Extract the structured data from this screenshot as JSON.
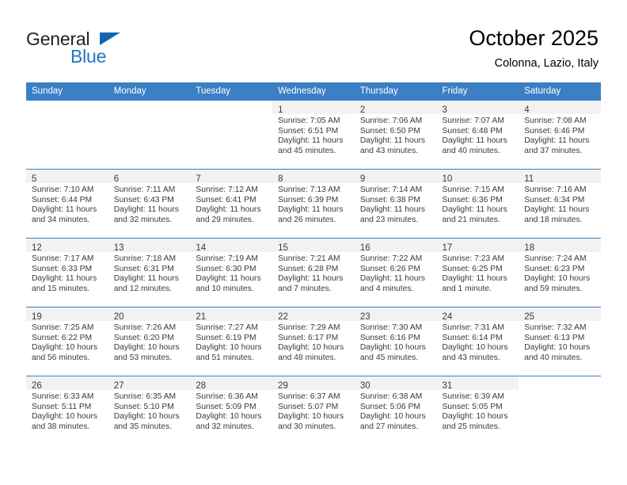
{
  "brand": {
    "name_part1": "General",
    "name_part2": "Blue",
    "accent_color": "#2175c4",
    "triangle_color": "#1565ad",
    "logo_icon": "triangle-icon"
  },
  "header": {
    "title": "October 2025",
    "subtitle": "Colonna, Lazio, Italy"
  },
  "calendar": {
    "header_bg": "#3b7fc4",
    "daynum_bg": "#f2f2f2",
    "weekday_labels": [
      "Sunday",
      "Monday",
      "Tuesday",
      "Wednesday",
      "Thursday",
      "Friday",
      "Saturday"
    ],
    "weeks": [
      [
        {
          "day": "",
          "lines": []
        },
        {
          "day": "",
          "lines": []
        },
        {
          "day": "",
          "lines": []
        },
        {
          "day": "1",
          "lines": [
            "Sunrise: 7:05 AM",
            "Sunset: 6:51 PM",
            "Daylight: 11 hours",
            "and 45 minutes."
          ]
        },
        {
          "day": "2",
          "lines": [
            "Sunrise: 7:06 AM",
            "Sunset: 6:50 PM",
            "Daylight: 11 hours",
            "and 43 minutes."
          ]
        },
        {
          "day": "3",
          "lines": [
            "Sunrise: 7:07 AM",
            "Sunset: 6:48 PM",
            "Daylight: 11 hours",
            "and 40 minutes."
          ]
        },
        {
          "day": "4",
          "lines": [
            "Sunrise: 7:08 AM",
            "Sunset: 6:46 PM",
            "Daylight: 11 hours",
            "and 37 minutes."
          ]
        }
      ],
      [
        {
          "day": "5",
          "lines": [
            "Sunrise: 7:10 AM",
            "Sunset: 6:44 PM",
            "Daylight: 11 hours",
            "and 34 minutes."
          ]
        },
        {
          "day": "6",
          "lines": [
            "Sunrise: 7:11 AM",
            "Sunset: 6:43 PM",
            "Daylight: 11 hours",
            "and 32 minutes."
          ]
        },
        {
          "day": "7",
          "lines": [
            "Sunrise: 7:12 AM",
            "Sunset: 6:41 PM",
            "Daylight: 11 hours",
            "and 29 minutes."
          ]
        },
        {
          "day": "8",
          "lines": [
            "Sunrise: 7:13 AM",
            "Sunset: 6:39 PM",
            "Daylight: 11 hours",
            "and 26 minutes."
          ]
        },
        {
          "day": "9",
          "lines": [
            "Sunrise: 7:14 AM",
            "Sunset: 6:38 PM",
            "Daylight: 11 hours",
            "and 23 minutes."
          ]
        },
        {
          "day": "10",
          "lines": [
            "Sunrise: 7:15 AM",
            "Sunset: 6:36 PM",
            "Daylight: 11 hours",
            "and 21 minutes."
          ]
        },
        {
          "day": "11",
          "lines": [
            "Sunrise: 7:16 AM",
            "Sunset: 6:34 PM",
            "Daylight: 11 hours",
            "and 18 minutes."
          ]
        }
      ],
      [
        {
          "day": "12",
          "lines": [
            "Sunrise: 7:17 AM",
            "Sunset: 6:33 PM",
            "Daylight: 11 hours",
            "and 15 minutes."
          ]
        },
        {
          "day": "13",
          "lines": [
            "Sunrise: 7:18 AM",
            "Sunset: 6:31 PM",
            "Daylight: 11 hours",
            "and 12 minutes."
          ]
        },
        {
          "day": "14",
          "lines": [
            "Sunrise: 7:19 AM",
            "Sunset: 6:30 PM",
            "Daylight: 11 hours",
            "and 10 minutes."
          ]
        },
        {
          "day": "15",
          "lines": [
            "Sunrise: 7:21 AM",
            "Sunset: 6:28 PM",
            "Daylight: 11 hours",
            "and 7 minutes."
          ]
        },
        {
          "day": "16",
          "lines": [
            "Sunrise: 7:22 AM",
            "Sunset: 6:26 PM",
            "Daylight: 11 hours",
            "and 4 minutes."
          ]
        },
        {
          "day": "17",
          "lines": [
            "Sunrise: 7:23 AM",
            "Sunset: 6:25 PM",
            "Daylight: 11 hours",
            "and 1 minute."
          ]
        },
        {
          "day": "18",
          "lines": [
            "Sunrise: 7:24 AM",
            "Sunset: 6:23 PM",
            "Daylight: 10 hours",
            "and 59 minutes."
          ]
        }
      ],
      [
        {
          "day": "19",
          "lines": [
            "Sunrise: 7:25 AM",
            "Sunset: 6:22 PM",
            "Daylight: 10 hours",
            "and 56 minutes."
          ]
        },
        {
          "day": "20",
          "lines": [
            "Sunrise: 7:26 AM",
            "Sunset: 6:20 PM",
            "Daylight: 10 hours",
            "and 53 minutes."
          ]
        },
        {
          "day": "21",
          "lines": [
            "Sunrise: 7:27 AM",
            "Sunset: 6:19 PM",
            "Daylight: 10 hours",
            "and 51 minutes."
          ]
        },
        {
          "day": "22",
          "lines": [
            "Sunrise: 7:29 AM",
            "Sunset: 6:17 PM",
            "Daylight: 10 hours",
            "and 48 minutes."
          ]
        },
        {
          "day": "23",
          "lines": [
            "Sunrise: 7:30 AM",
            "Sunset: 6:16 PM",
            "Daylight: 10 hours",
            "and 45 minutes."
          ]
        },
        {
          "day": "24",
          "lines": [
            "Sunrise: 7:31 AM",
            "Sunset: 6:14 PM",
            "Daylight: 10 hours",
            "and 43 minutes."
          ]
        },
        {
          "day": "25",
          "lines": [
            "Sunrise: 7:32 AM",
            "Sunset: 6:13 PM",
            "Daylight: 10 hours",
            "and 40 minutes."
          ]
        }
      ],
      [
        {
          "day": "26",
          "lines": [
            "Sunrise: 6:33 AM",
            "Sunset: 5:11 PM",
            "Daylight: 10 hours",
            "and 38 minutes."
          ]
        },
        {
          "day": "27",
          "lines": [
            "Sunrise: 6:35 AM",
            "Sunset: 5:10 PM",
            "Daylight: 10 hours",
            "and 35 minutes."
          ]
        },
        {
          "day": "28",
          "lines": [
            "Sunrise: 6:36 AM",
            "Sunset: 5:09 PM",
            "Daylight: 10 hours",
            "and 32 minutes."
          ]
        },
        {
          "day": "29",
          "lines": [
            "Sunrise: 6:37 AM",
            "Sunset: 5:07 PM",
            "Daylight: 10 hours",
            "and 30 minutes."
          ]
        },
        {
          "day": "30",
          "lines": [
            "Sunrise: 6:38 AM",
            "Sunset: 5:06 PM",
            "Daylight: 10 hours",
            "and 27 minutes."
          ]
        },
        {
          "day": "31",
          "lines": [
            "Sunrise: 6:39 AM",
            "Sunset: 5:05 PM",
            "Daylight: 10 hours",
            "and 25 minutes."
          ]
        },
        {
          "day": "",
          "lines": []
        }
      ]
    ]
  }
}
